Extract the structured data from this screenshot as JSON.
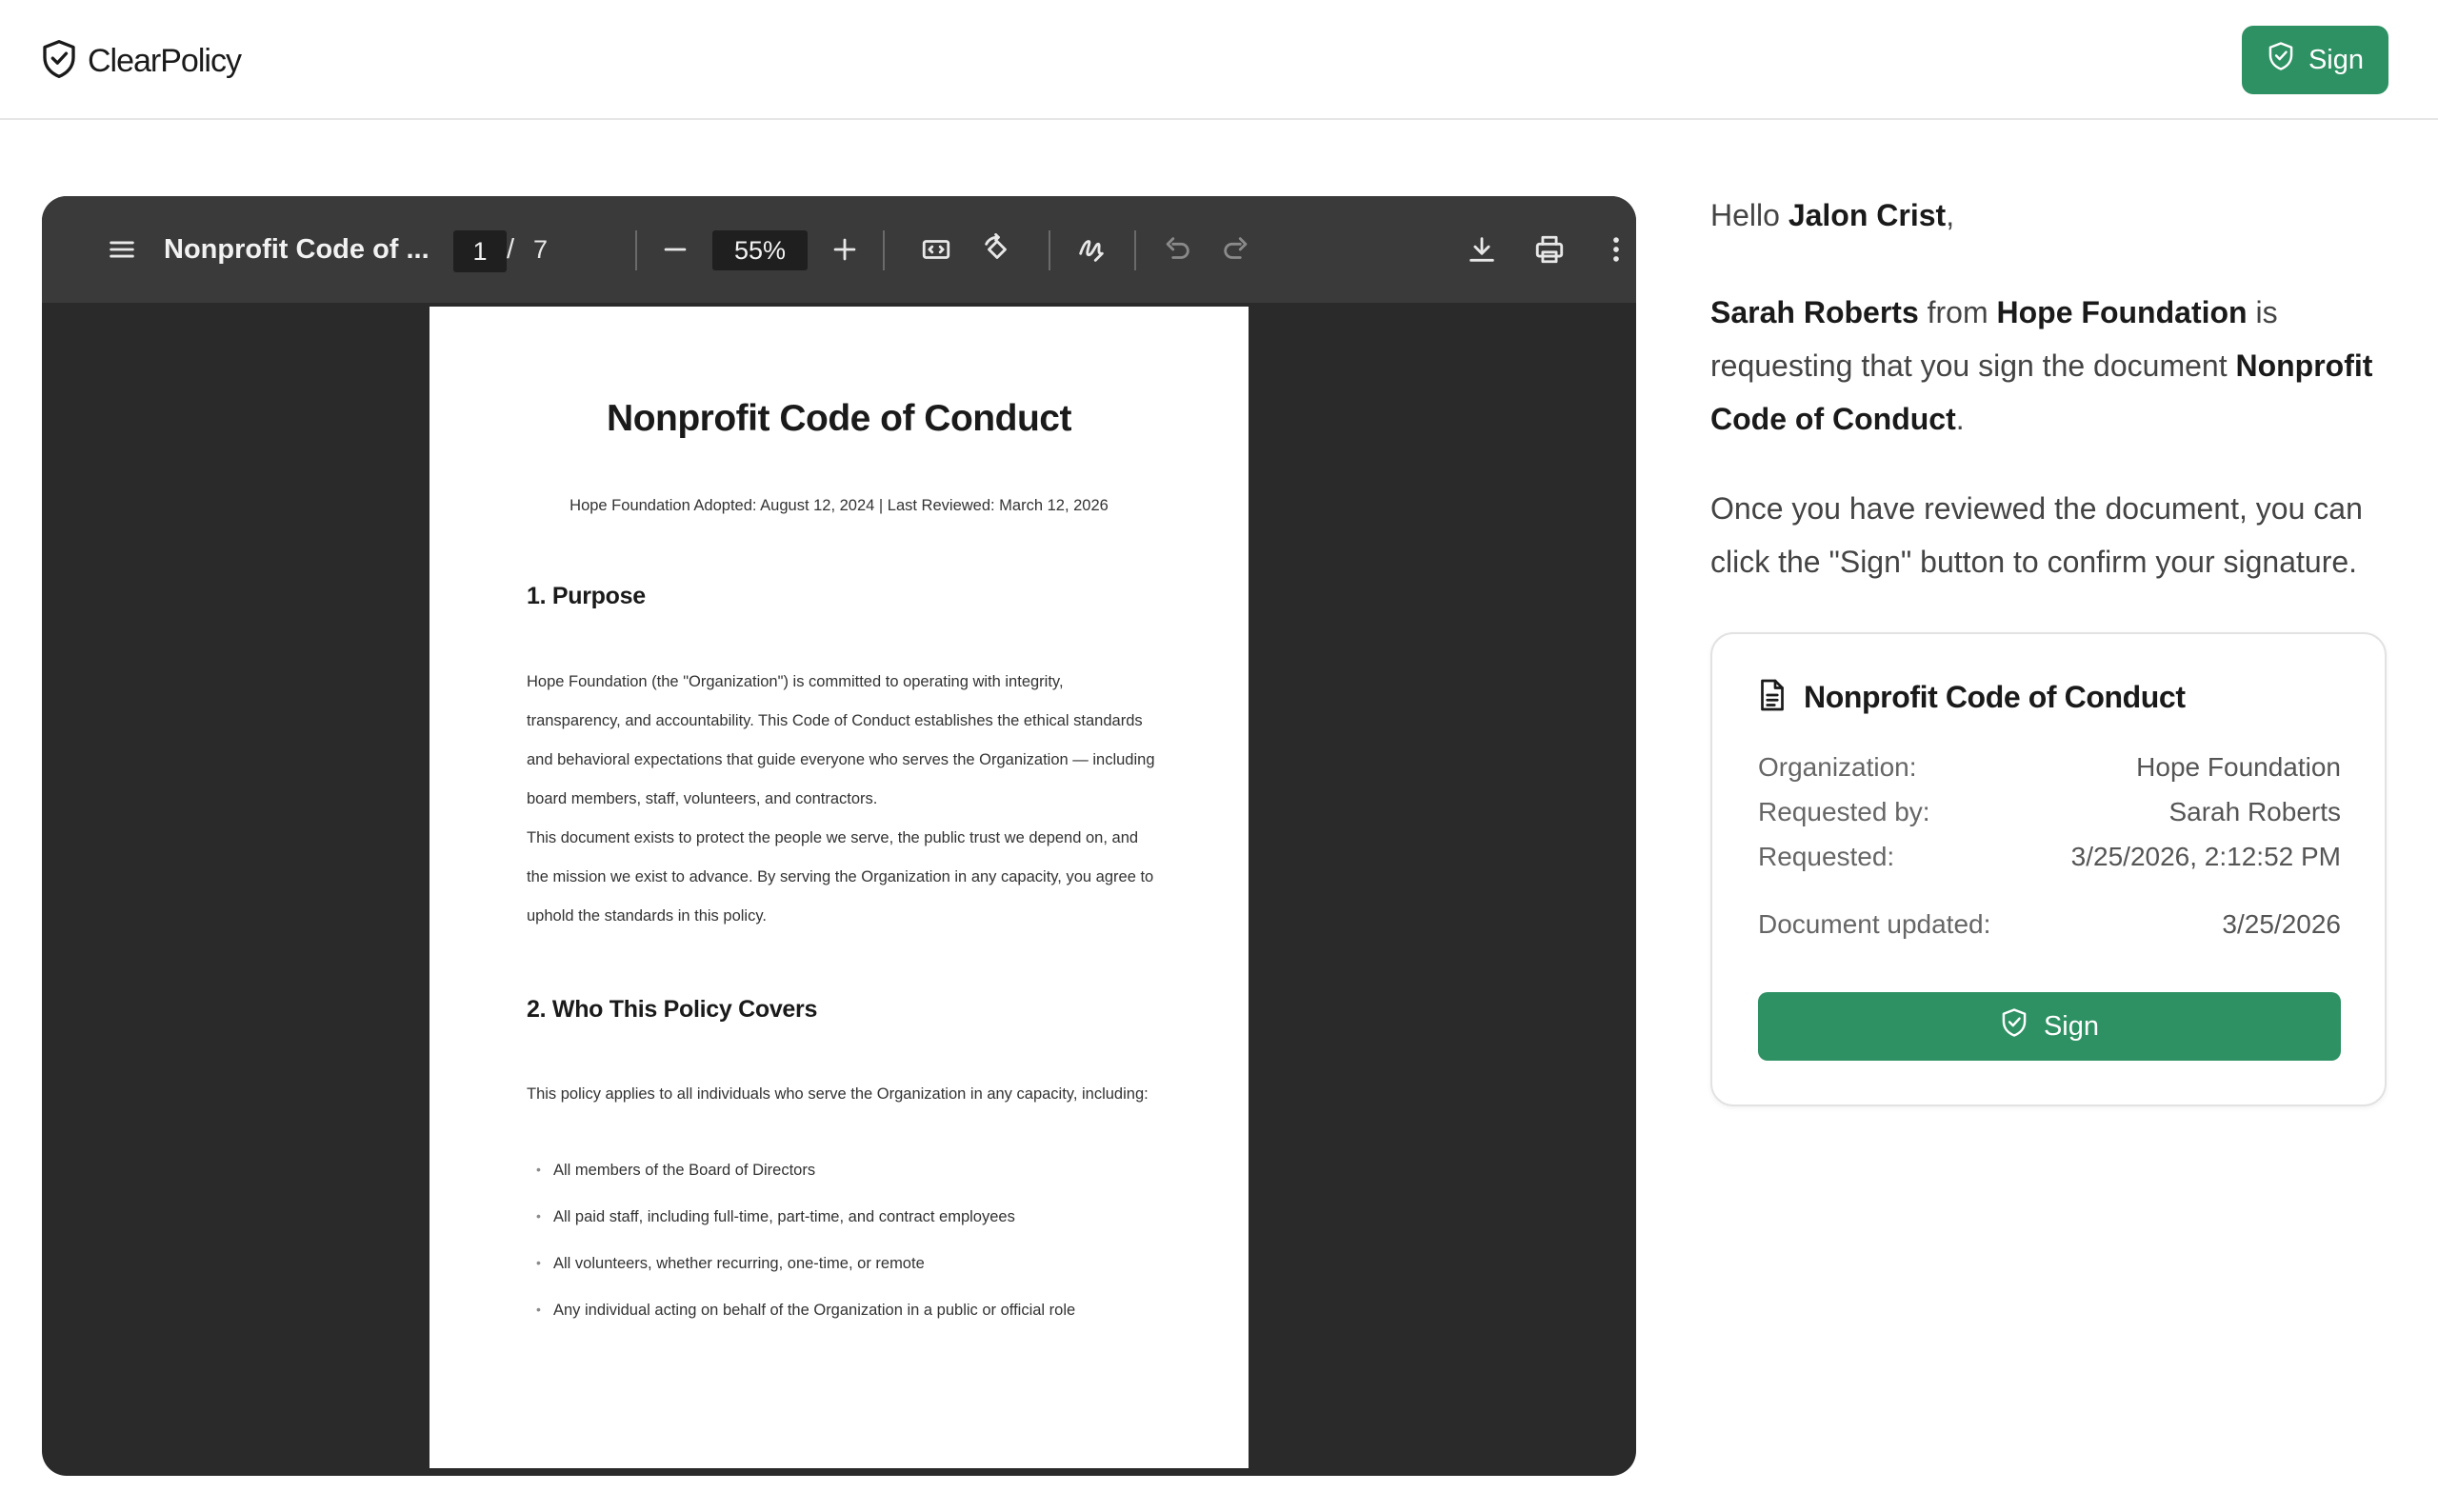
{
  "brand": {
    "name": "ClearPolicy",
    "icon": "shield-check-icon"
  },
  "header": {
    "sign_label": "Sign"
  },
  "viewer": {
    "doc_title": "Nonprofit Code of ...",
    "page_current": "1",
    "page_separator": "/",
    "page_total": "7",
    "zoom": "55%",
    "icons": [
      "menu-icon",
      "zoom-out-icon",
      "zoom-in-icon",
      "fit-page-icon",
      "rotate-icon",
      "annotate-icon",
      "undo-icon",
      "redo-icon",
      "download-icon",
      "print-icon",
      "more-icon"
    ]
  },
  "document": {
    "title": "Nonprofit Code of Conduct",
    "meta": "Hope Foundation Adopted: August 12, 2024 | Last Reviewed: March 12, 2026",
    "sections": [
      {
        "heading": "1. Purpose",
        "paragraphs": [
          "Hope Foundation (the \"Organization\") is committed to operating with integrity, transparency, and accountability. This Code of Conduct establishes the ethical standards and behavioral expectations that guide everyone who serves the Organization — including board members, staff, volunteers, and contractors.",
          "This document exists to protect the people we serve, the public trust we depend on, and the mission we exist to advance. By serving the Organization in any capacity, you agree to uphold the standards in this policy."
        ]
      },
      {
        "heading": "2. Who This Policy Covers",
        "paragraphs": [
          "This policy applies to all individuals who serve the Organization in any capacity, including:"
        ],
        "bullets": [
          "All members of the Board of Directors",
          "All paid staff, including full-time, part-time, and contract employees",
          "All volunteers, whether recurring, one-time, or remote",
          "Any individual acting on behalf of the Organization in a public or official role"
        ]
      }
    ]
  },
  "panel": {
    "greeting_prefix": "Hello ",
    "recipient": "Jalon Crist",
    "greeting_suffix": ",",
    "requester": "Sarah Roberts",
    "from_text": " from ",
    "organization": "Hope Foundation",
    "request_text": " is requesting that you sign the document ",
    "document_name": "Nonprofit Code of Conduct",
    "period": ".",
    "instructions": "Once you have reviewed the document, you can click the \"Sign\" button to confirm your signature.",
    "card": {
      "title": "Nonprofit Code of Conduct",
      "rows": [
        {
          "label": "Organization:",
          "value": "Hope Foundation"
        },
        {
          "label": "Requested by:",
          "value": "Sarah Roberts"
        },
        {
          "label": "Requested:",
          "value": "3/25/2026, 2:12:52 PM"
        },
        {
          "label": "Document updated:",
          "value": "3/25/2026"
        }
      ],
      "sign_label": "Sign"
    }
  },
  "colors": {
    "accent": "#2e9163",
    "viewer_bg": "#2a2a2a",
    "toolbar_bg": "#3a3a3a"
  }
}
